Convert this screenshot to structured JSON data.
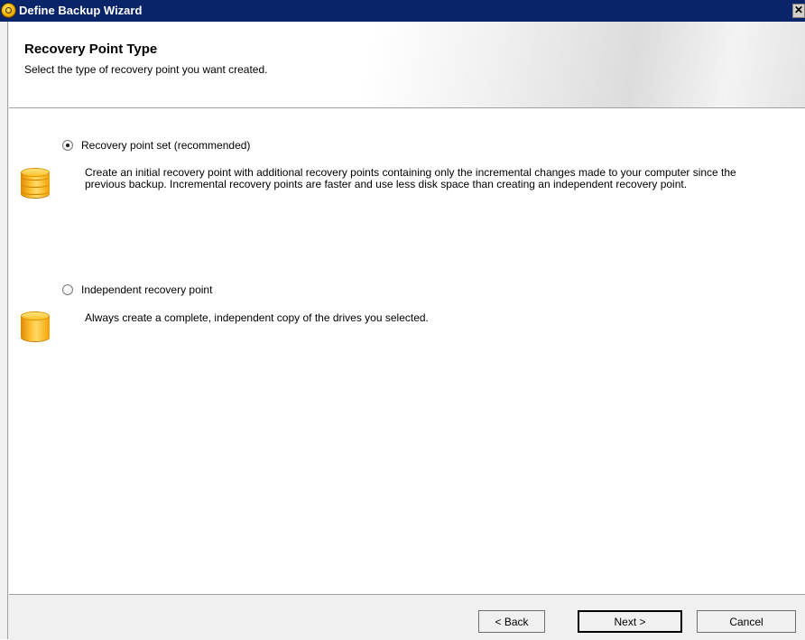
{
  "window": {
    "title": "Define Backup Wizard",
    "close_label": "✕"
  },
  "header": {
    "title": "Recovery Point Type",
    "subtitle": "Select the type of recovery point you want created."
  },
  "options": [
    {
      "label": "Recovery point set (recommended)",
      "selected": true,
      "icon": "database-stack-icon",
      "description": "Create an initial recovery point with additional recovery points containing only the incremental changes made to your computer since the previous backup. Incremental recovery points are faster and use less disk space than creating an independent recovery point."
    },
    {
      "label": "Independent recovery point",
      "selected": false,
      "icon": "database-icon",
      "description": "Always create a complete, independent copy of the drives you selected."
    }
  ],
  "buttons": {
    "back": "< Back",
    "next": "Next >",
    "cancel": "Cancel"
  },
  "colors": {
    "titlebar": "#0a246a",
    "icon_accent": "#f4b400"
  }
}
